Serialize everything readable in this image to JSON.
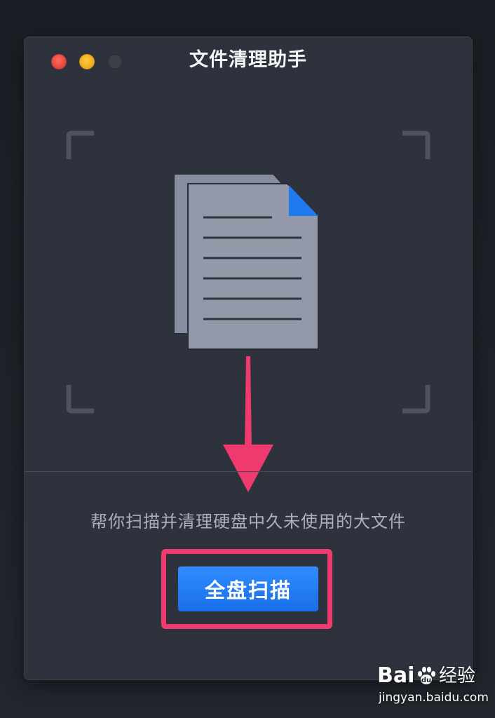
{
  "window": {
    "title": "文件清理助手",
    "controls": {
      "close": "close-light",
      "minimize": "minimize-light",
      "zoom": "zoom-light"
    }
  },
  "main": {
    "illustration_icon": "document-stack-icon",
    "arrow_icon": "arrow-down-icon",
    "description": "帮你扫描并清理硬盘中久未使用的大文件",
    "scan_button_label": "全盘扫描"
  },
  "watermark": {
    "brand": "Bai",
    "brand_cn": "经验",
    "url": "jingyan.baidu.com"
  },
  "colors": {
    "window_bg": "#2e323c",
    "accent_blue": "#1f7af0",
    "annotation_pink": "#ee3a6f",
    "document_gray": "#9399a8"
  }
}
